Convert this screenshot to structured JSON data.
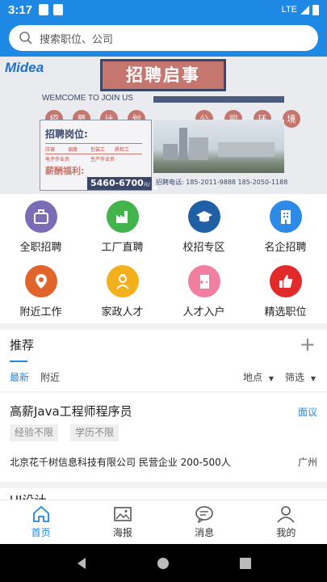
{
  "status_bar": {
    "time": "3:17",
    "network": "LTE"
  },
  "search": {
    "placeholder": "搜索职位、公司"
  },
  "banner": {
    "brand": "Midea",
    "title": "招聘启事",
    "welcome": "WEMCOME TO JOIN US",
    "plan_chars": [
      "招",
      "募",
      "计",
      "划"
    ],
    "company_chars": [
      "公",
      "司",
      "环",
      "境"
    ],
    "positions_title": "招聘岗位:",
    "positions": [
      "压铸",
      "调度",
      "包装工",
      "质检工",
      "电子作业员",
      "生产作业员"
    ],
    "benefits_title": "薪酬福利:",
    "salary": "5460-6700",
    "salary_unit": "元/月",
    "phone": "招聘电话: 185-2011-9888   185-2050-1188"
  },
  "categories": [
    {
      "label": "全职招聘",
      "icon": "briefcase-icon",
      "color": "#7c6bb5"
    },
    {
      "label": "工厂直聘",
      "icon": "factory-icon",
      "color": "#43b34b"
    },
    {
      "label": "校招专区",
      "icon": "graduation-cap-icon",
      "color": "#1f5fa6"
    },
    {
      "label": "名企招聘",
      "icon": "building-icon",
      "color": "#2d8ae6"
    },
    {
      "label": "附近工作",
      "icon": "location-pin-icon",
      "color": "#e0642c"
    },
    {
      "label": "家政人才",
      "icon": "nurse-icon",
      "color": "#f2b11c"
    },
    {
      "label": "人才入户",
      "icon": "door-icon",
      "color": "#f27ea0"
    },
    {
      "label": "精选职位",
      "icon": "thumbs-up-icon",
      "color": "#e32a2a"
    }
  ],
  "recommend": {
    "title": "推荐",
    "tabs": [
      "最新",
      "附近"
    ],
    "filters": [
      "地点",
      "筛选"
    ]
  },
  "job": {
    "title": "高薪Java工程师程序员",
    "salary": "面议",
    "tags": [
      "经验不限",
      "学历不限"
    ],
    "company_line": "北京花千树信息科技有限公司  民营企业  200-500人",
    "city": "广州"
  },
  "next_job_peek": "UI设计",
  "bottom_nav": [
    {
      "label": "首页",
      "icon": "home-icon",
      "active": true
    },
    {
      "label": "海报",
      "icon": "image-icon",
      "active": false
    },
    {
      "label": "消息",
      "icon": "message-icon",
      "active": false
    },
    {
      "label": "我的",
      "icon": "user-icon",
      "active": false
    }
  ],
  "colors": {
    "primary": "#1e88e5",
    "banner_accent": "#c5766f",
    "banner_dark": "#3b4768"
  }
}
